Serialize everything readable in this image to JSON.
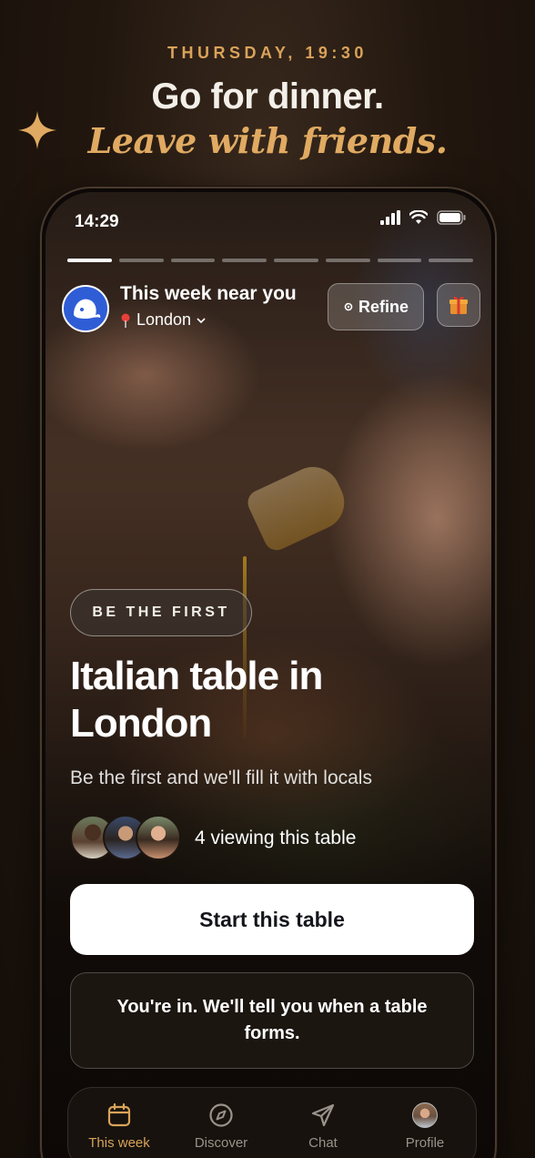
{
  "promo": {
    "date_label": "THURSDAY, 19:30",
    "title": "Go for dinner.",
    "subtitle": "Leave with friends."
  },
  "status_bar": {
    "time": "14:29"
  },
  "stories_progress": {
    "total": 8,
    "active_index": 0
  },
  "header": {
    "title": "This week near you",
    "location": "London",
    "refine_label": "Refine"
  },
  "card": {
    "badge": "BE THE FIRST",
    "title": "Italian table in London",
    "subtitle": "Be the first and we'll fill it with locals",
    "viewing_text": "4 viewing this table",
    "avatar_count": 3
  },
  "actions": {
    "start_label": "Start this table",
    "notice_text": "You're in. We'll tell you when a table forms."
  },
  "tab_bar": {
    "tabs": [
      {
        "label": "This week",
        "icon": "calendar-icon",
        "active": true
      },
      {
        "label": "Discover",
        "icon": "compass-icon",
        "active": false
      },
      {
        "label": "Chat",
        "icon": "send-icon",
        "active": false
      },
      {
        "label": "Profile",
        "icon": "profile-avatar",
        "active": false
      }
    ]
  },
  "colors": {
    "accent": "#d9a35a",
    "background": "#1b130d",
    "logo_blue": "#2f5dd6",
    "button_bg": "#ffffff",
    "button_text": "#15161c"
  }
}
